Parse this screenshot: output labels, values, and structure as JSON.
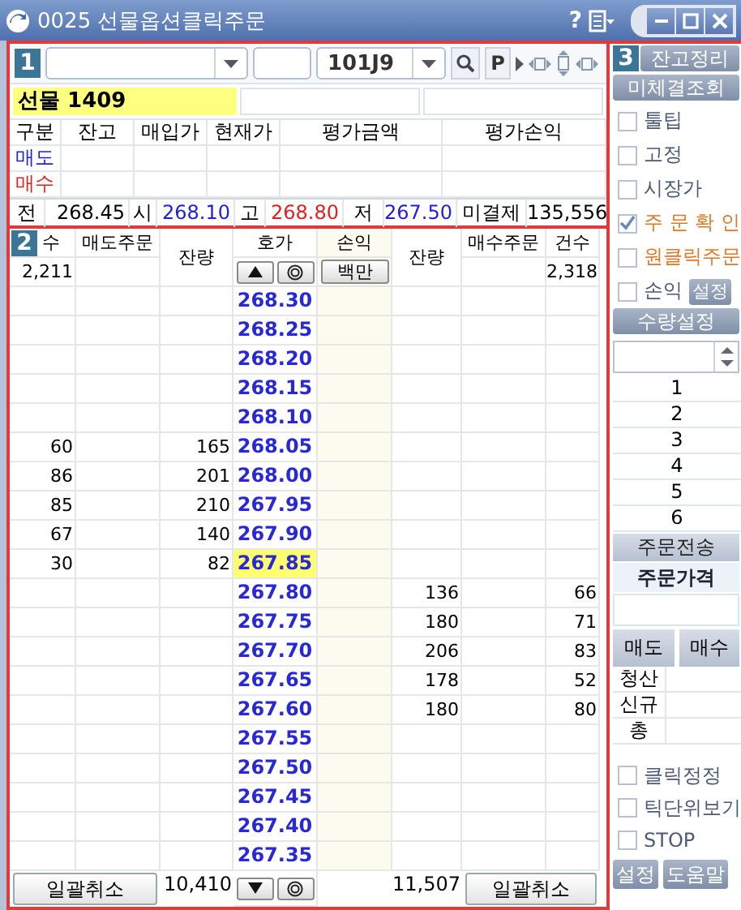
{
  "window": {
    "title": "0025 선물옵션클릭주문",
    "help": "?"
  },
  "panel1": {
    "badge": "1",
    "code": "101J9",
    "p_button": "P",
    "product": "선물 1409",
    "balance": {
      "columns": [
        "구분",
        "잔고",
        "매입가",
        "현재가",
        "평가금액",
        "평가손익"
      ],
      "rows": [
        {
          "label": "매도",
          "color": "#2020e0"
        },
        {
          "label": "매수",
          "color": "#e02020"
        }
      ]
    },
    "quote": [
      {
        "label": "전",
        "value": "268.45",
        "color": "#000000"
      },
      {
        "label": "시",
        "value": "268.10",
        "color": "#2020e0"
      },
      {
        "label": "고",
        "value": "268.80",
        "color": "#e02020"
      },
      {
        "label": "저",
        "value": "267.50",
        "color": "#2020e0"
      },
      {
        "label": "미결제",
        "value": "135,556",
        "color": "#000000"
      }
    ]
  },
  "orderbook": {
    "badge": "2",
    "columns": [
      "수",
      "매도주문",
      "잔량",
      "호가",
      "손익",
      "잔량",
      "매수주문",
      "건수"
    ],
    "sell_count_total": "2,211",
    "buy_count_total": "2,318",
    "pnl_button": "백만",
    "rows": [
      {
        "price": "268.30",
        "current": false
      },
      {
        "price": "268.25",
        "current": false
      },
      {
        "price": "268.20",
        "current": false
      },
      {
        "price": "268.15",
        "current": false
      },
      {
        "price": "268.10",
        "current": false
      },
      {
        "sell_count": "60",
        "sell_qty": "165",
        "price": "268.05",
        "current": false
      },
      {
        "sell_count": "86",
        "sell_qty": "201",
        "price": "268.00",
        "current": false
      },
      {
        "sell_count": "85",
        "sell_qty": "210",
        "price": "267.95",
        "current": false
      },
      {
        "sell_count": "67",
        "sell_qty": "140",
        "price": "267.90",
        "current": false
      },
      {
        "sell_count": "30",
        "sell_qty": "82",
        "price": "267.85",
        "current": true
      },
      {
        "price": "267.80",
        "buy_qty": "136",
        "buy_count": "66",
        "current": false
      },
      {
        "price": "267.75",
        "buy_qty": "180",
        "buy_count": "71",
        "current": false
      },
      {
        "price": "267.70",
        "buy_qty": "206",
        "buy_count": "83",
        "current": false
      },
      {
        "price": "267.65",
        "buy_qty": "178",
        "buy_count": "52",
        "current": false
      },
      {
        "price": "267.60",
        "buy_qty": "180",
        "buy_count": "80",
        "current": false
      },
      {
        "price": "267.55",
        "current": false
      },
      {
        "price": "267.50",
        "current": false
      },
      {
        "price": "267.45",
        "current": false
      },
      {
        "price": "267.40",
        "current": false
      },
      {
        "price": "267.35",
        "current": false
      }
    ],
    "footer": {
      "cancel_sell": "일괄취소",
      "sell_total": "10,410",
      "buy_total": "11,507",
      "cancel_buy": "일괄취소"
    }
  },
  "side": {
    "badge": "3",
    "top_buttons": [
      "잔고정리",
      "미체결조회"
    ],
    "options": [
      {
        "label": "툴팁",
        "checked": false,
        "color": "#4a5a78"
      },
      {
        "label": "고정",
        "checked": false,
        "color": "#4a5a78"
      },
      {
        "label": "시장가",
        "checked": false,
        "color": "#4a5a78"
      },
      {
        "label": "주 문 확 인",
        "checked": true,
        "color": "#e07828"
      },
      {
        "label": "원클릭주문",
        "checked": false,
        "color": "#e07828"
      },
      {
        "label": "손익",
        "checked": false,
        "color": "#4a5a78",
        "button": "설정"
      }
    ],
    "qty_button": "수량설정",
    "qty_presets": [
      "1",
      "2",
      "3",
      "4",
      "5",
      "6"
    ],
    "send_button": "주문전송",
    "price_label": "주문가격",
    "sell_button": "매도",
    "buy_button": "매수",
    "position_rows": [
      "청산",
      "신규",
      "총"
    ],
    "bottom_options": [
      {
        "label": "클릭정정",
        "checked": false
      },
      {
        "label": "틱단위보기",
        "checked": false
      },
      {
        "label": "STOP",
        "checked": false
      }
    ],
    "bottom_buttons": [
      "설정",
      "도움말"
    ]
  }
}
